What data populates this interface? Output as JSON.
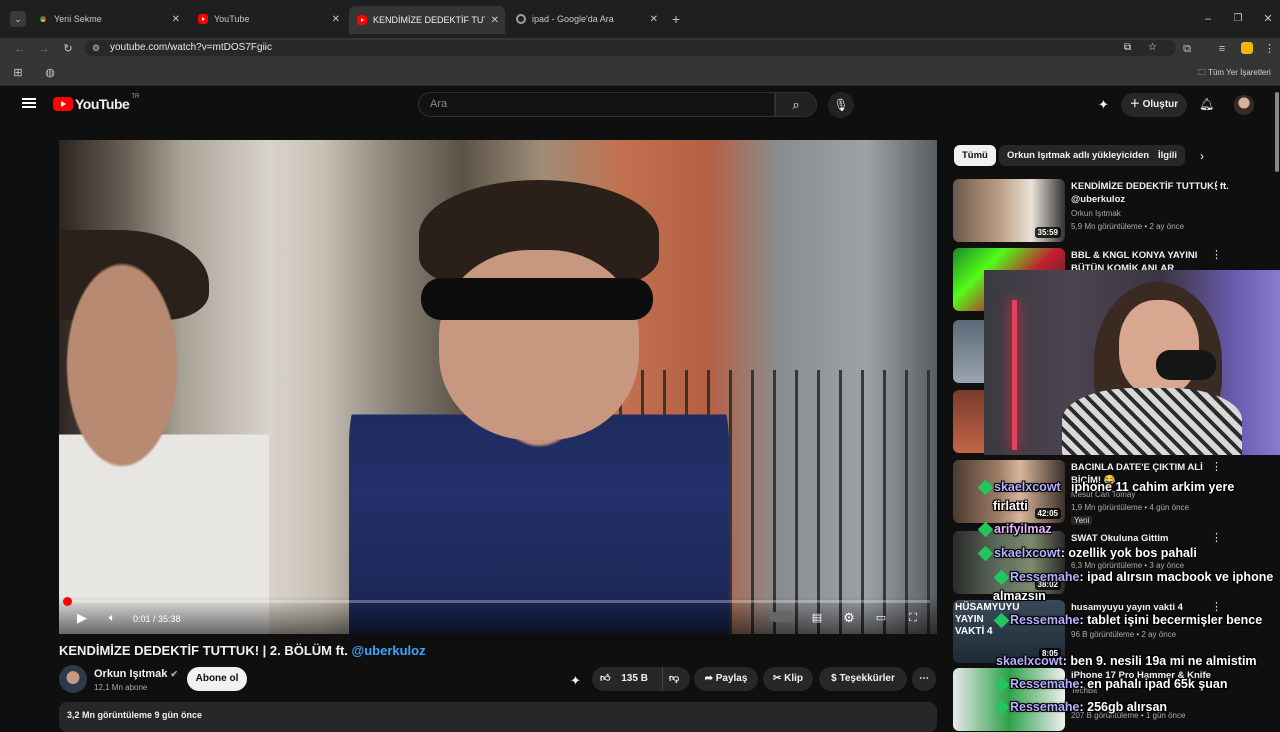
{
  "browser": {
    "tabs": [
      {
        "label": "Yeni Sekme",
        "icon": "chrome-icon",
        "active": false
      },
      {
        "label": "YouTube",
        "icon": "youtube-icon",
        "active": false
      },
      {
        "label": "KENDİMİZE DEDEKTİF TUTTUK",
        "icon": "youtube-icon",
        "active": true
      },
      {
        "label": "ipad - Google'da Ara",
        "icon": "google-icon",
        "active": false
      }
    ],
    "url": "youtube.com/watch?v=mtDOS7Fgiic",
    "bookmarks_label": "Tüm Yer İşaretleri"
  },
  "youtube": {
    "logo_text": "YouTube",
    "logo_region": "TR",
    "search_placeholder": "Ara",
    "create_label": "Oluştur"
  },
  "player": {
    "time": "0:01 / 35:38",
    "progress": 0.0005
  },
  "video": {
    "title_prefix": "KENDİMİZE DEDEKTİF TUTTUK! | 2. BÖLÜM ft.",
    "title_link": "@uberkuloz",
    "channel": "Orkun Işıtmak",
    "subscribers": "12,1 Mn abone",
    "subscribe_label": "Abone ol",
    "likes": "135 B",
    "share_label": "Paylaş",
    "clip_label": "Klip",
    "thanks_label": "Teşekkürler",
    "views_line": "3,2 Mn görüntüleme  9 gün önce"
  },
  "chips": [
    "Tümü",
    "Orkun Işıtmak adlı yükleyiciden",
    "İlgili"
  ],
  "recommendations": [
    {
      "title": "KENDİMİZE DEDEKTİF TUTTUK! ft. @uberkuloz",
      "channel": "Orkun Işıtmak",
      "meta": "5,9 Mn görüntüleme • 2 ay önce",
      "duration": "35:59"
    },
    {
      "title": "BBL & KNGL KONYA YAYINI BÜTÜN KOMİK ANLAR",
      "channel": "",
      "meta": "",
      "duration": ""
    },
    {
      "title": "BACINLA DATE'E ÇIKTIM ALİ BİÇİM! 😂",
      "channel": "Mesut Can Tomay",
      "meta": "1,9 Mn görüntüleme • 4 gün önce",
      "duration": "42:05",
      "badge": "Yeni"
    },
    {
      "title": "SWAT Okuluna Gittim",
      "channel": "",
      "meta": "6,3 Mn görüntüleme • 3 ay önce",
      "duration": "38:02"
    },
    {
      "title": "husamyuyu yayın vakti 4",
      "channel": "",
      "meta": "96 B görüntüleme • 2 ay önce",
      "duration": "8:05",
      "thumb_text": "HÜSAMYUYU YAYIN VAKTİ 4"
    },
    {
      "title": "iPhone 17 Pro Hammer & Knife",
      "channel": "TechBit",
      "meta": "207 B görüntüleme • 1 gün önce",
      "duration": ""
    }
  ],
  "chat_overlay": [
    {
      "user": "",
      "text": "iphone 11 cahim arkim yere"
    },
    {
      "user": "skaelxcowt",
      "text": ""
    },
    {
      "user": "",
      "text": "firlatti"
    },
    {
      "user": "arifyilmaz",
      "text": ""
    },
    {
      "user": "skaelxcowt",
      "text": ": ozellik yok bos pahali"
    },
    {
      "user": "Ressemahe",
      "text": ": ipad alırsın macbook ve iphone"
    },
    {
      "user": "",
      "text": "almazsın"
    },
    {
      "user": "Ressemahe",
      "text": ": tablet işini becermişler bence"
    },
    {
      "user": "skaelxcowt",
      "text": ": ben 9. nesili 19a mi ne almistim"
    },
    {
      "user": "Ressemahe",
      "text": ": en pahalı ipad 65k şuan"
    },
    {
      "user": "Ressemahe",
      "text": ": 256gb alırsan"
    }
  ],
  "colors": {
    "accent": "#ff0000",
    "link": "#3ea6ff",
    "chat_user": "#b6b0ff",
    "badge": "#22c55e"
  }
}
